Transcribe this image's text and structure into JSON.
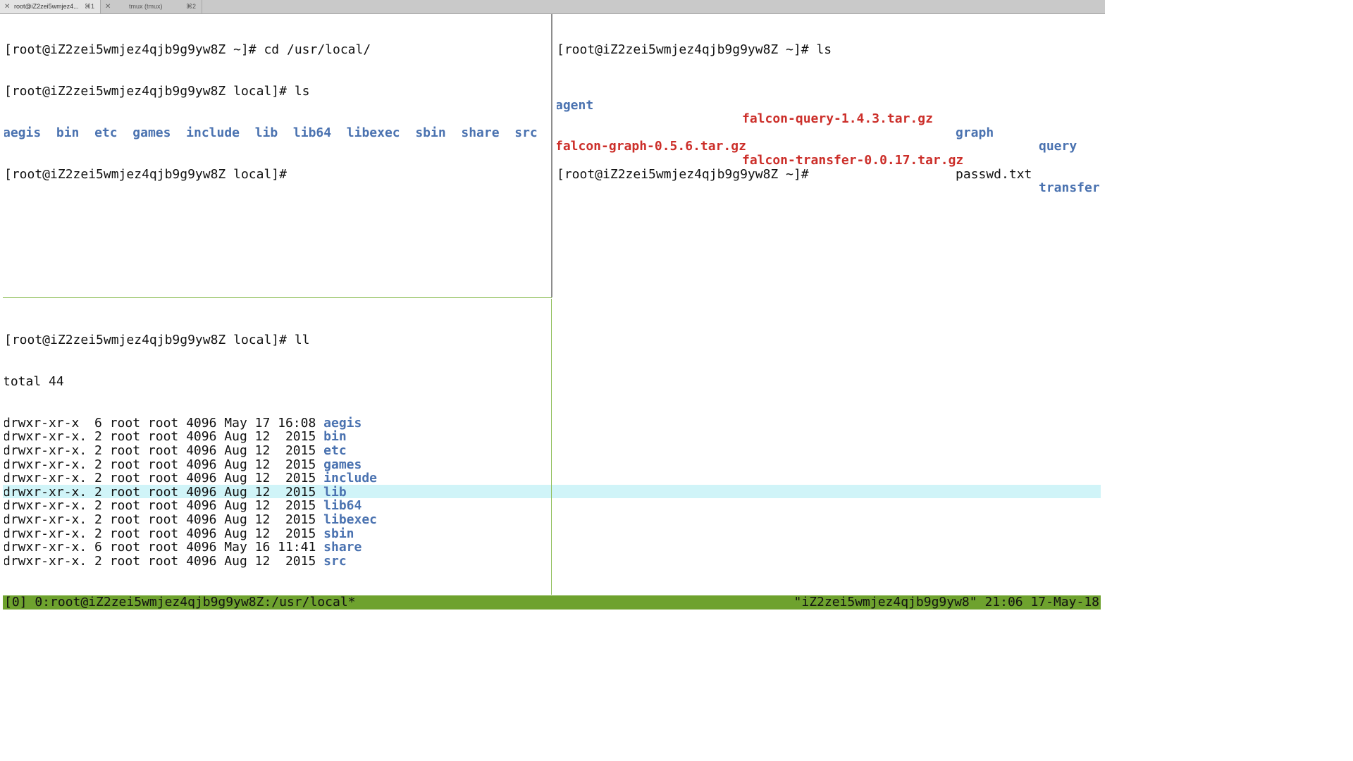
{
  "tabs": [
    {
      "title": "root@iZ2zei5wmjez4...",
      "shortcut": "⌘1",
      "active": true
    },
    {
      "title": "tmux (tmux)",
      "shortcut": "⌘2",
      "active": false
    }
  ],
  "pane_top_left": {
    "prompt": "[root@iZ2zei5wmjez4qjb9g9yw8Z ~]# ",
    "prompt_local": "[root@iZ2zei5wmjez4qjb9g9yw8Z local]# ",
    "cmd1": "cd /usr/local/",
    "cmd2": "ls",
    "ls_entries": [
      "aegis",
      "bin",
      "etc",
      "games",
      "include",
      "lib",
      "lib64",
      "libexec",
      "sbin",
      "share",
      "src"
    ]
  },
  "pane_top_right": {
    "prompt": "[root@iZ2zei5wmjez4qjb9g9yw8Z ~]# ",
    "cmd": "ls",
    "row1": {
      "c1": "agent",
      "c2": "falcon-query-1.4.3.tar.gz",
      "c3": "graph",
      "c4": "query"
    },
    "row2": {
      "c1": "falcon-graph-0.5.6.tar.gz",
      "c2": "falcon-transfer-0.0.17.tar.gz",
      "c3": "passwd.txt",
      "c4": "transfer"
    }
  },
  "pane_bottom_left": {
    "prompt": "[root@iZ2zei5wmjez4qjb9g9yw8Z local]# ",
    "cmd": "ll",
    "total": "total 44",
    "rows": [
      {
        "meta": "drwxr-xr-x  6 root root 4096 May 17 16:08 ",
        "name": "aegis"
      },
      {
        "meta": "drwxr-xr-x. 2 root root 4096 Aug 12  2015 ",
        "name": "bin"
      },
      {
        "meta": "drwxr-xr-x. 2 root root 4096 Aug 12  2015 ",
        "name": "etc"
      },
      {
        "meta": "drwxr-xr-x. 2 root root 4096 Aug 12  2015 ",
        "name": "games"
      },
      {
        "meta": "drwxr-xr-x. 2 root root 4096 Aug 12  2015 ",
        "name": "include"
      },
      {
        "meta": "drwxr-xr-x. 2 root root 4096 Aug 12  2015 ",
        "name": "lib"
      },
      {
        "meta": "drwxr-xr-x. 2 root root 4096 Aug 12  2015 ",
        "name": "lib64"
      },
      {
        "meta": "drwxr-xr-x. 2 root root 4096 Aug 12  2015 ",
        "name": "libexec"
      },
      {
        "meta": "drwxr-xr-x. 2 root root 4096 Aug 12  2015 ",
        "name": "sbin"
      },
      {
        "meta": "drwxr-xr-x. 6 root root 4096 May 16 11:41 ",
        "name": "share"
      },
      {
        "meta": "drwxr-xr-x. 2 root root 4096 Aug 12  2015 ",
        "name": "src"
      }
    ]
  },
  "statusbar": {
    "left": "[0] 0:root@iZ2zei5wmjez4qjb9g9yw8Z:/usr/local*",
    "right": "\"iZ2zei5wmjez4qjb9g9yw8\" 21:06 17-May-18"
  },
  "colors": {
    "directory": "#4a72b0",
    "archive": "#cc2f2a",
    "statusbar": "#6ea22e",
    "active_line": "#d0f4f8"
  }
}
